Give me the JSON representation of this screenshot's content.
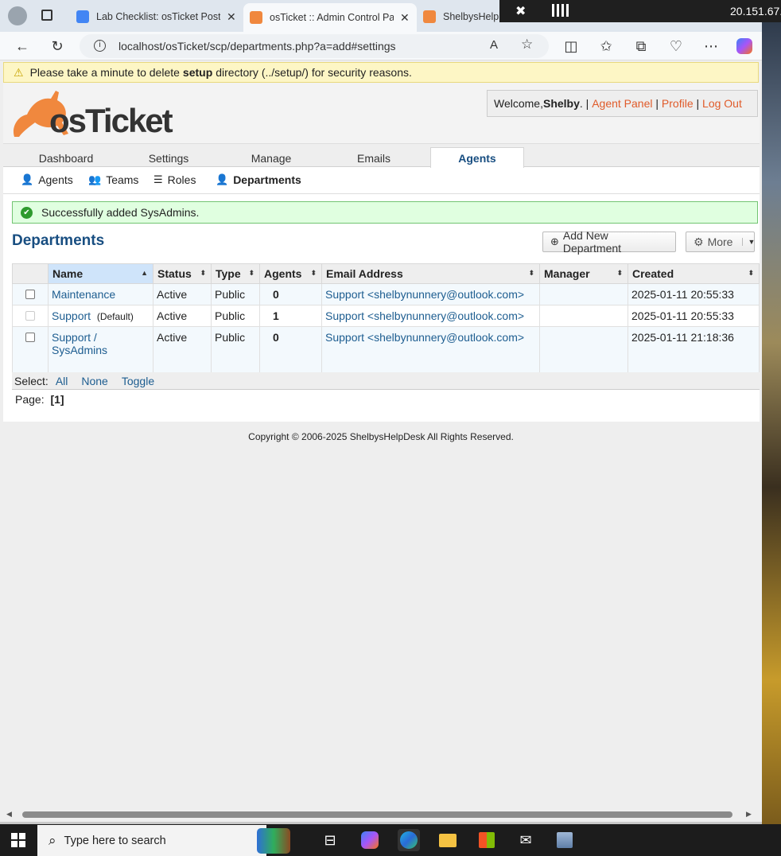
{
  "browser": {
    "tabs": [
      {
        "title": "Lab Checklist: osTicket Post-In",
        "icon": "google-docs-icon",
        "active": false
      },
      {
        "title": "osTicket :: Admin Control Pan",
        "icon": "osticket-icon",
        "active": true
      },
      {
        "title": "ShelbysHelpD",
        "icon": "osticket-icon",
        "active": false
      }
    ],
    "url": "localhost/osTicket/scp/departments.php?a=add#settings",
    "remote_ip": "20.151.67."
  },
  "warning": {
    "pre": "Please take a minute to delete ",
    "strong": "setup",
    "post": " directory (../setup/) for security reasons."
  },
  "header": {
    "logo_text": "osTicket",
    "welcome_prefix": "Welcome, ",
    "user": "Shelby",
    "links": [
      "Agent Panel",
      "Profile",
      "Log Out"
    ]
  },
  "nav": {
    "tabs": [
      "Dashboard",
      "Settings",
      "Manage",
      "Emails",
      "Agents"
    ],
    "active": "Agents"
  },
  "subnav": [
    "Agents",
    "Teams",
    "Roles",
    "Departments"
  ],
  "message": "Successfully added SysAdmins.",
  "page_title": "Departments",
  "buttons": {
    "add": "Add New Department",
    "more": "More"
  },
  "table": {
    "columns": [
      "Name",
      "Status",
      "Type",
      "Agents",
      "Email Address",
      "Manager",
      "Created"
    ],
    "rows": [
      {
        "name": "Maintenance",
        "default": "",
        "status": "Active",
        "type": "Public",
        "agents": "0",
        "email": "Support <shelbynunnery@outlook.com>",
        "manager": "",
        "created": "2025-01-11 20:55:33"
      },
      {
        "name": "Support",
        "default": "(Default)",
        "status": "Active",
        "type": "Public",
        "agents": "1",
        "email": "Support <shelbynunnery@outlook.com>",
        "manager": "",
        "created": "2025-01-11 20:55:33"
      },
      {
        "name": "Support / SysAdmins",
        "default": "",
        "status": "Active",
        "type": "Public",
        "agents": "0",
        "email": "Support <shelbynunnery@outlook.com>",
        "manager": "",
        "created": "2025-01-11 21:18:36"
      }
    ]
  },
  "select": {
    "label": "Select:",
    "options": [
      "All",
      "None",
      "Toggle"
    ]
  },
  "pager": {
    "label": "Page:",
    "current": "[1]"
  },
  "footer": "Copyright © 2006-2025 ShelbysHelpDesk All Rights Reserved.",
  "taskbar": {
    "search_placeholder": "Type here to search"
  },
  "colors": {
    "brand_orange": "#e05b2a",
    "title_blue": "#184e81",
    "link_blue": "#1d5d90",
    "success_bg": "#e0ffe0"
  }
}
